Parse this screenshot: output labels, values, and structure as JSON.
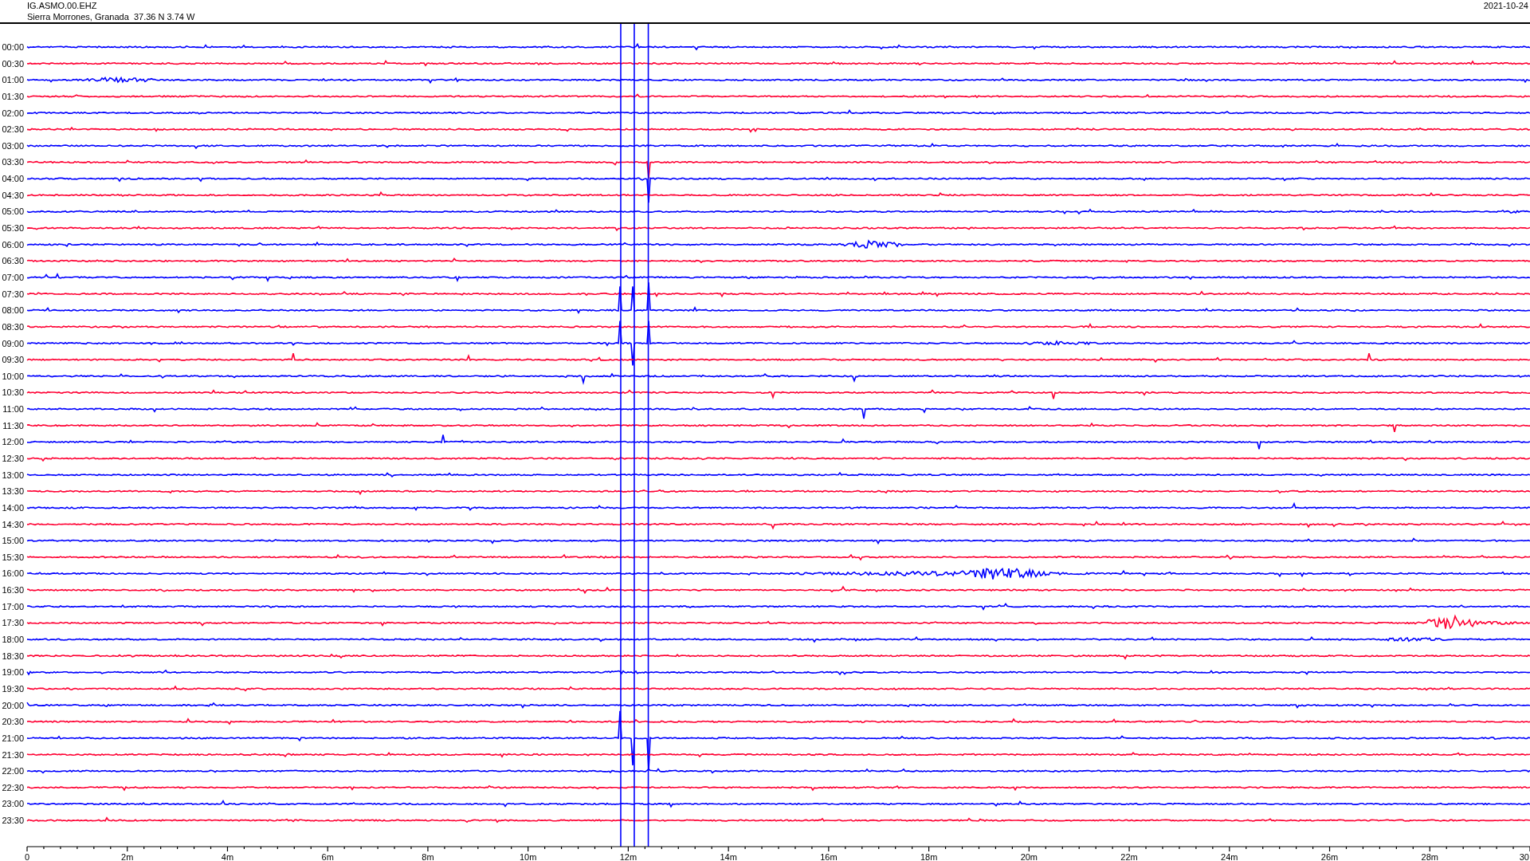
{
  "header": {
    "station": "IG.ASMO.00.EHZ",
    "location": "Sierra Morrones, Granada  37.36 N 3.74 W",
    "date": "2021-10-24"
  },
  "rows": [
    {
      "label": "00:00",
      "color": "#0000ff"
    },
    {
      "label": "00:30",
      "color": "#ff0033"
    },
    {
      "label": "01:00",
      "color": "#0000ff"
    },
    {
      "label": "01:30",
      "color": "#ff0033"
    },
    {
      "label": "02:00",
      "color": "#0000ff"
    },
    {
      "label": "02:30",
      "color": "#ff0033"
    },
    {
      "label": "03:00",
      "color": "#0000ff"
    },
    {
      "label": "03:30",
      "color": "#ff0033"
    },
    {
      "label": "04:00",
      "color": "#0000ff"
    },
    {
      "label": "04:30",
      "color": "#ff0033"
    },
    {
      "label": "05:00",
      "color": "#0000ff"
    },
    {
      "label": "05:30",
      "color": "#ff0033"
    },
    {
      "label": "06:00",
      "color": "#0000ff"
    },
    {
      "label": "06:30",
      "color": "#ff0033"
    },
    {
      "label": "07:00",
      "color": "#0000ff"
    },
    {
      "label": "07:30",
      "color": "#ff0033"
    },
    {
      "label": "08:00",
      "color": "#0000ff"
    },
    {
      "label": "08:30",
      "color": "#ff0033"
    },
    {
      "label": "09:00",
      "color": "#0000ff"
    },
    {
      "label": "09:30",
      "color": "#ff0033"
    },
    {
      "label": "10:00",
      "color": "#0000ff"
    },
    {
      "label": "10:30",
      "color": "#ff0033"
    },
    {
      "label": "11:00",
      "color": "#0000ff"
    },
    {
      "label": "11:30",
      "color": "#ff0033"
    },
    {
      "label": "12:00",
      "color": "#0000ff"
    },
    {
      "label": "12:30",
      "color": "#ff0033"
    },
    {
      "label": "13:00",
      "color": "#0000ff"
    },
    {
      "label": "13:30",
      "color": "#ff0033"
    },
    {
      "label": "14:00",
      "color": "#0000ff"
    },
    {
      "label": "14:30",
      "color": "#ff0033"
    },
    {
      "label": "15:00",
      "color": "#0000ff"
    },
    {
      "label": "15:30",
      "color": "#ff0033"
    },
    {
      "label": "16:00",
      "color": "#0000ff"
    },
    {
      "label": "16:30",
      "color": "#ff0033"
    },
    {
      "label": "17:00",
      "color": "#0000ff"
    },
    {
      "label": "17:30",
      "color": "#ff0033"
    },
    {
      "label": "18:00",
      "color": "#0000ff"
    },
    {
      "label": "18:30",
      "color": "#ff0033"
    },
    {
      "label": "19:00",
      "color": "#0000ff"
    },
    {
      "label": "19:30",
      "color": "#ff0033"
    },
    {
      "label": "20:00",
      "color": "#0000ff"
    },
    {
      "label": "20:30",
      "color": "#ff0033"
    },
    {
      "label": "21:00",
      "color": "#0000ff"
    },
    {
      "label": "21:30",
      "color": "#ff0033"
    },
    {
      "label": "22:00",
      "color": "#0000ff"
    },
    {
      "label": "22:30",
      "color": "#ff0033"
    },
    {
      "label": "23:00",
      "color": "#0000ff"
    },
    {
      "label": "23:30",
      "color": "#ff0033"
    }
  ],
  "axis": {
    "ticks": [
      "0",
      "2m",
      "4m",
      "6m",
      "8m",
      "10m",
      "12m",
      "14m",
      "16m",
      "18m",
      "20m",
      "22m",
      "24m",
      "26m",
      "28m",
      "30"
    ]
  }
}
